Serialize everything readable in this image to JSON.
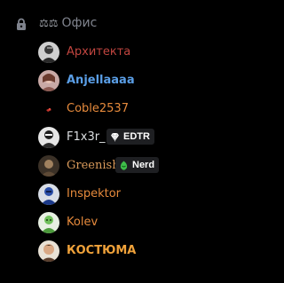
{
  "channel": {
    "name": "Офис",
    "prefix_symbol": "⚖⚖",
    "lock_icon": "lock-icon",
    "name_color": "#80848e"
  },
  "users": [
    {
      "name": "Архитекта",
      "color": "#c0453f",
      "avatar_icon": "avatar-grey-figure"
    },
    {
      "name": "Anjellaaaa",
      "color": "#5a9ee6",
      "avatar_icon": "avatar-pink-figure"
    },
    {
      "name": "Coble2537",
      "color": "#e68a3c",
      "avatar_icon": "avatar-red-mark"
    },
    {
      "name": "F1x3r_",
      "color": "#dbdee1",
      "avatar_icon": "avatar-dark-figure",
      "badge": {
        "label": "EDTR",
        "icon": "diamond-icon"
      }
    },
    {
      "name": "Greenish",
      "color": "#d99a5b",
      "avatar_icon": "avatar-brown-figure",
      "badge": {
        "label": "Nerd",
        "icon": "green-gem-icon"
      }
    },
    {
      "name": "Inspektor",
      "color": "#e68a3c",
      "avatar_icon": "avatar-blue-figure"
    },
    {
      "name": "Kolev",
      "color": "#e68a3c",
      "avatar_icon": "avatar-green-figure"
    },
    {
      "name": "КОСТЮМА",
      "color": "#f0a23a",
      "avatar_icon": "avatar-face-figure"
    }
  ]
}
